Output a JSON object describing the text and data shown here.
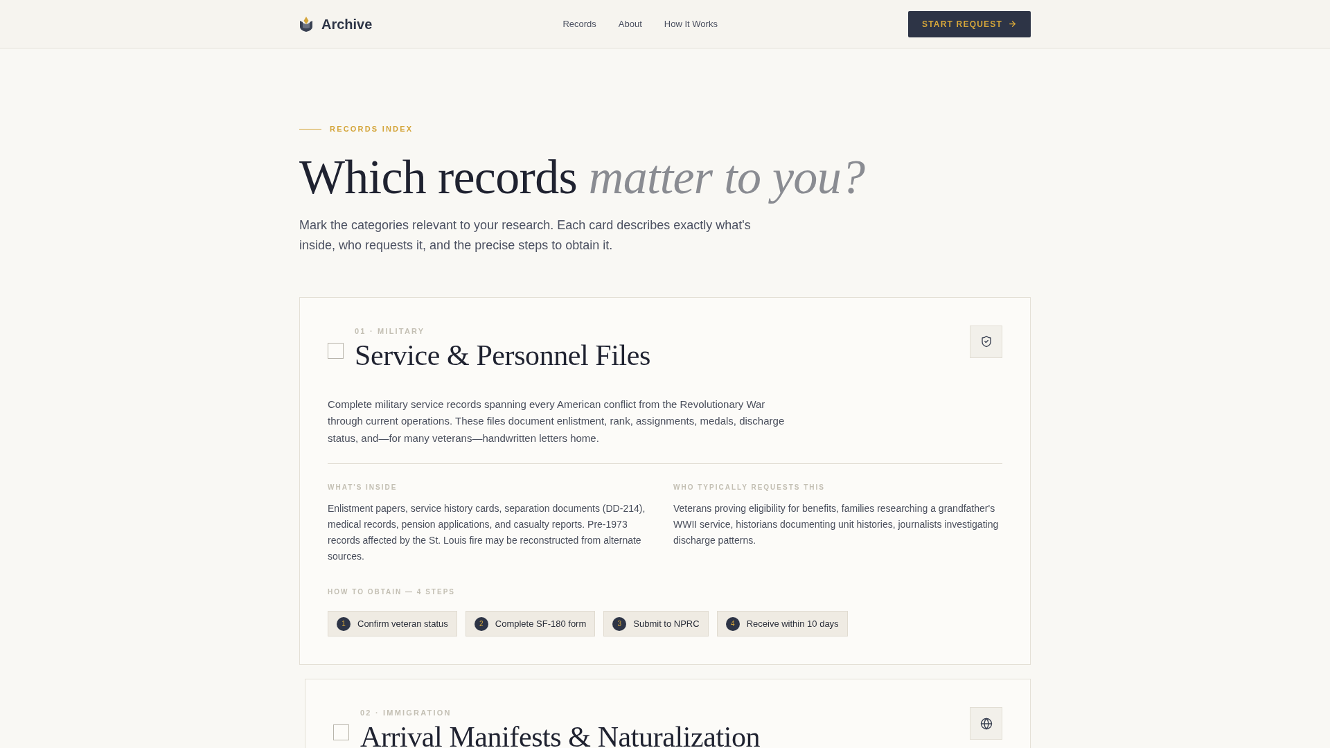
{
  "header": {
    "brand": "Archive",
    "nav": [
      {
        "label": "Records"
      },
      {
        "label": "About"
      },
      {
        "label": "How It Works"
      }
    ],
    "cta": "START REQUEST"
  },
  "hero": {
    "eyebrow": "RECORDS INDEX",
    "title": "Which records *matter to you?*",
    "intro": "Mark the categories relevant to your research. Each card describes exactly what's inside, who requests it, and the precise steps to obtain it."
  },
  "cards": [
    {
      "checked": false,
      "meta": "01 · MILITARY",
      "title": "Service & Personnel Files",
      "description": "Complete military service records spanning every American conflict from the Revolutionary War through current operations. These files document enlistment, rank, assignments, medals, discharge status, and—for many veterans—handwritten letters home.",
      "sections": [
        {
          "heading": "WHAT'S INSIDE",
          "text": "Enlistment papers, service history cards, separation documents (DD-214), medical records, pension applications, and casualty reports. Pre-1973 records affected by the St. Louis fire may be reconstructed from alternate sources."
        },
        {
          "heading": "WHO TYPICALLY REQUESTS THIS",
          "text": "Veterans proving eligibility for benefits, families researching a grandfather's WWII service, historians documenting unit histories, journalists investigating discharge patterns."
        }
      ],
      "steps_heading": "HOW TO OBTAIN — 4 STEPS",
      "steps": [
        {
          "number": "1",
          "label": "Confirm veteran status"
        },
        {
          "number": "2",
          "label": "Complete SF-180 form"
        },
        {
          "number": "3",
          "label": "Submit to NPRC"
        },
        {
          "number": "4",
          "label": "Receive within 10 days"
        }
      ]
    },
    {
      "checked": false,
      "meta": "02 · IMMIGRATION",
      "title": "Arrival Manifests & Naturalization"
    }
  ]
}
